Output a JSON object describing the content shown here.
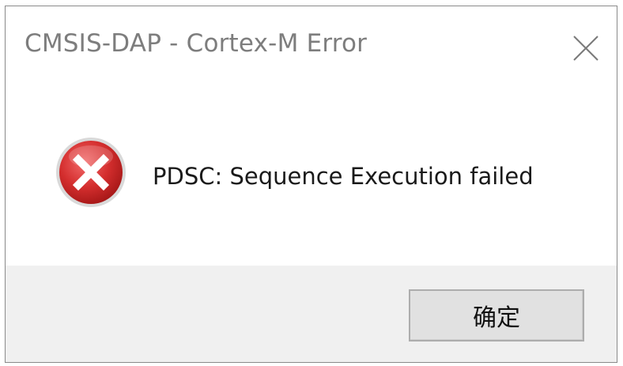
{
  "dialog": {
    "title": "CMSIS-DAP - Cortex-M Error",
    "close_icon": "close-icon",
    "icon": "error-icon",
    "message": "PDSC: Sequence Execution failed",
    "ok_label": "确定"
  },
  "colors": {
    "title_text": "#7d7d7d",
    "footer_bg": "#f0f0f0",
    "error_red": "#d32f2f",
    "button_bg": "#e1e1e1",
    "button_border": "#adadad"
  }
}
